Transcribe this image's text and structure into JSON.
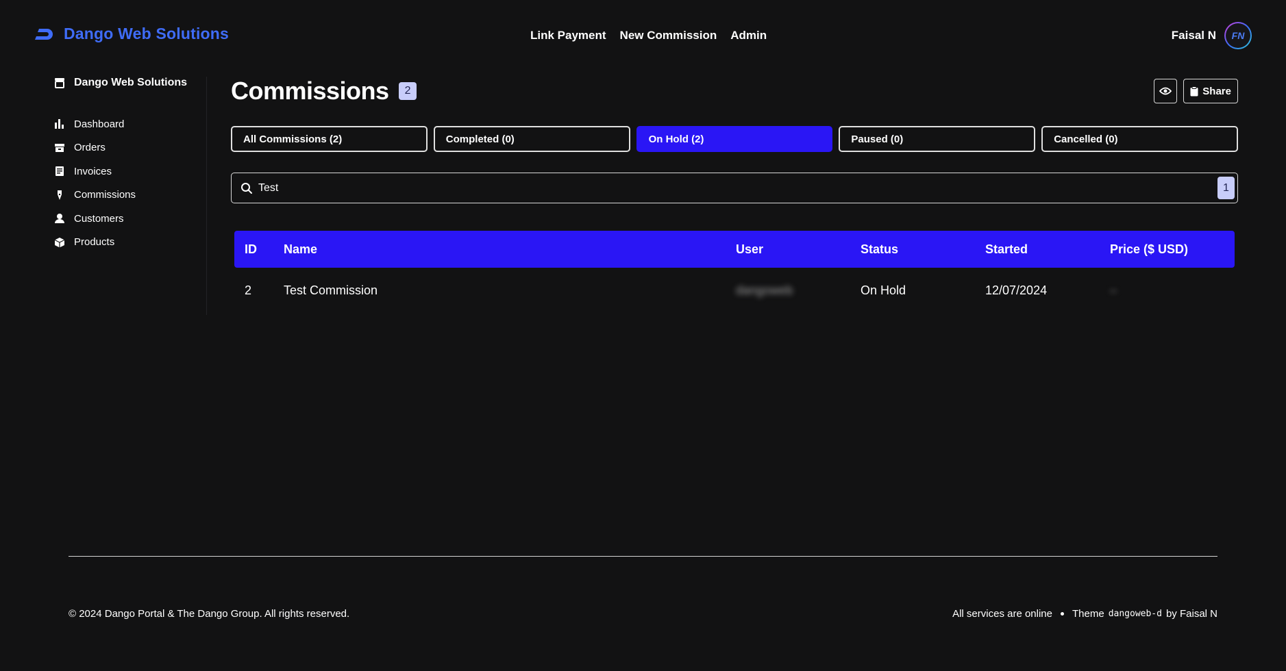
{
  "brand": {
    "name": "Dango Web Solutions",
    "accent": "#3f6cf7"
  },
  "nav": {
    "links": [
      "Link Payment",
      "New Commission",
      "Admin"
    ]
  },
  "user": {
    "name": "Faisal N",
    "initials": "FN"
  },
  "sidebar": {
    "title": "Dango Web Solutions",
    "items": [
      {
        "label": "Dashboard",
        "icon": "bar-chart-icon"
      },
      {
        "label": "Orders",
        "icon": "archive-box-icon"
      },
      {
        "label": "Invoices",
        "icon": "receipt-icon"
      },
      {
        "label": "Commissions",
        "icon": "pen-nib-icon"
      },
      {
        "label": "Customers",
        "icon": "user-icon"
      },
      {
        "label": "Products",
        "icon": "cube-icon"
      }
    ]
  },
  "main": {
    "title": "Commissions",
    "count": "2",
    "share_label": "Share",
    "filters": [
      {
        "label": "All Commissions (2)",
        "active": false
      },
      {
        "label": "Completed (0)",
        "active": false
      },
      {
        "label": "On Hold (2)",
        "active": true
      },
      {
        "label": "Paused (0)",
        "active": false
      },
      {
        "label": "Cancelled (0)",
        "active": false
      }
    ],
    "search": {
      "value": "Test",
      "result_count": "1"
    },
    "table": {
      "headers": [
        "ID",
        "Name",
        "User",
        "Status",
        "Started",
        "Price ($ USD)"
      ],
      "rows": [
        {
          "id": "2",
          "name": "Test Commission",
          "user": "dangoweb",
          "status": "On Hold",
          "started": "12/07/2024",
          "price": "–"
        }
      ]
    }
  },
  "footer": {
    "copyright": "© 2024 Dango Portal & The Dango Group. All rights reserved.",
    "status": "All services are online",
    "theme_prefix": "Theme",
    "theme_name": "dangoweb-d",
    "theme_suffix": "by Faisal N"
  },
  "colors": {
    "background": "#121213",
    "primary": "#2a16f5",
    "badge": "#c8cdfa"
  }
}
